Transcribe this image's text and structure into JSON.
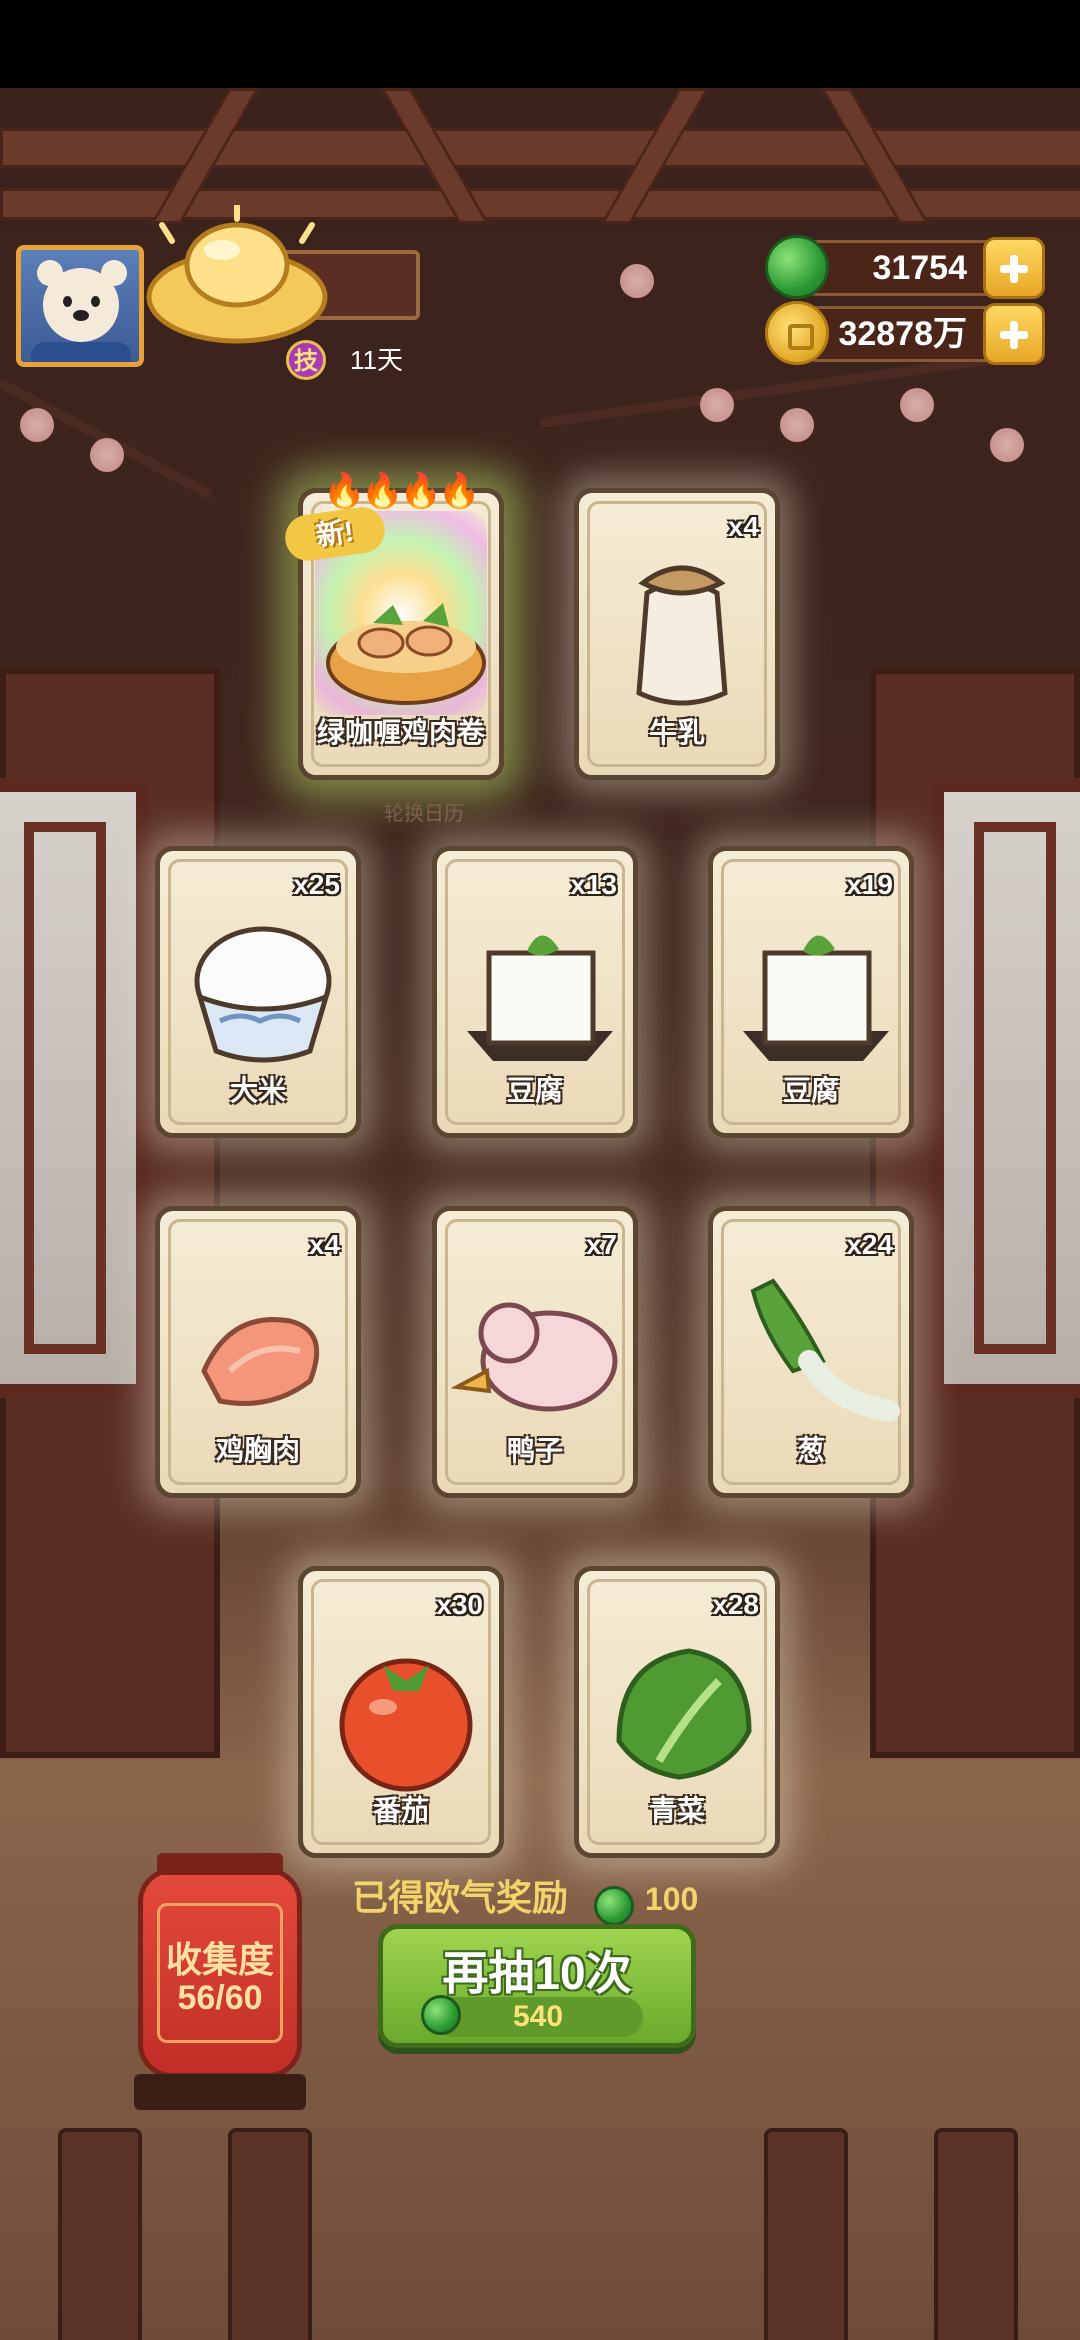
{
  "resources": {
    "jade": "31754",
    "coins": "32878万"
  },
  "player": {
    "skill_badge": "技",
    "days": "11天"
  },
  "featured_card": {
    "name": "绿咖喱鸡肉卷",
    "new_tag": "新!",
    "caption": "轮换日历"
  },
  "cards": [
    {
      "name": "牛乳",
      "count": "x4"
    },
    {
      "name": "大米",
      "count": "x25"
    },
    {
      "name": "豆腐",
      "count": "x13"
    },
    {
      "name": "豆腐",
      "count": "x19"
    },
    {
      "name": "鸡胸肉",
      "count": "x4"
    },
    {
      "name": "鸭子",
      "count": "x7"
    },
    {
      "name": "葱",
      "count": "x24"
    },
    {
      "name": "番茄",
      "count": "x30"
    },
    {
      "name": "青菜",
      "count": "x28"
    }
  ],
  "reward": {
    "label": "已得欧气奖励",
    "amount": "100"
  },
  "collection": {
    "title": "收集度",
    "progress": "56/60"
  },
  "redraw": {
    "label": "再抽10次",
    "cost": "540"
  },
  "colors": {
    "accent_green": "#7fc03a",
    "gold": "#f3d46a",
    "lantern_red": "#d13a30"
  }
}
